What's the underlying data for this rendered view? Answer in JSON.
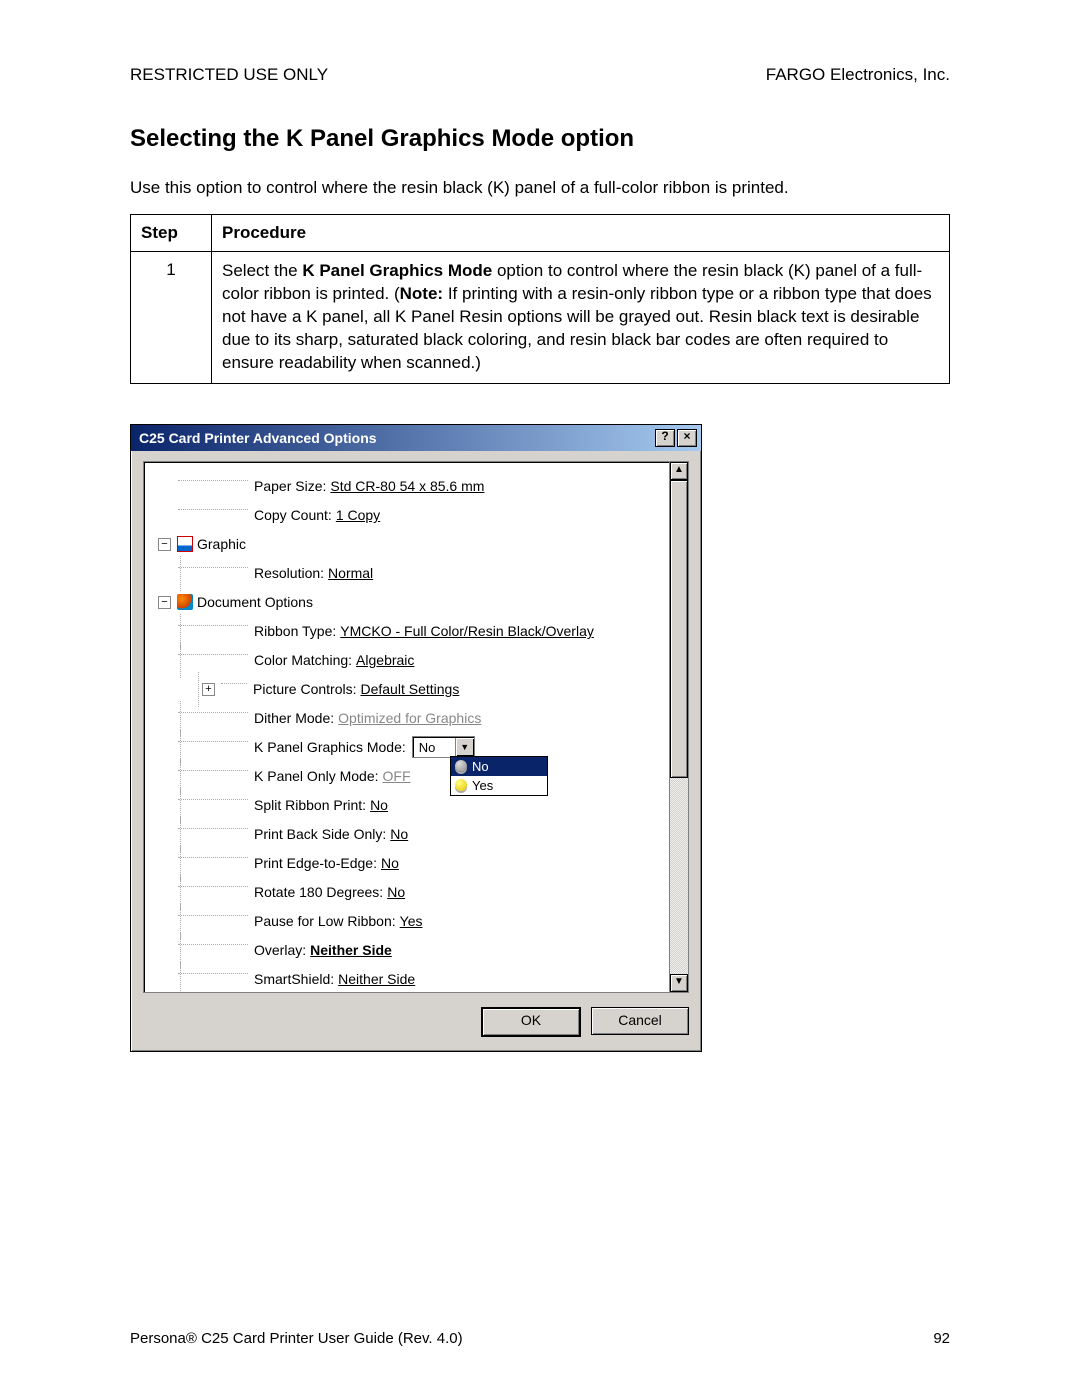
{
  "header": {
    "left": "RESTRICTED USE ONLY",
    "right": "FARGO Electronics, Inc."
  },
  "section_title": "Selecting the K Panel Graphics Mode option",
  "intro": "Use this option to control where the resin black (K) panel of a full-color ribbon is printed.",
  "table": {
    "header_step": "Step",
    "header_proc": "Procedure",
    "row": {
      "step": "1",
      "before_bold1": "Select the ",
      "bold1": "K Panel Graphics Mode",
      "mid": " option to control where the resin black (K) panel of a full-color ribbon is printed.  (",
      "bold2": "Note:",
      "after": "  If printing with a resin-only ribbon type or a ribbon type that does not have a K panel, all K Panel Resin options will be grayed out.  Resin black text is desirable due to its sharp, saturated black coloring, and resin black bar codes are often required to ensure readability when scanned.)"
    }
  },
  "dialog": {
    "title": "C25 Card Printer Advanced Options",
    "help_btn": "?",
    "close_btn": "×",
    "ok": "OK",
    "cancel": "Cancel",
    "scroll_up": "▲",
    "scroll_down": "▼",
    "tree": {
      "paper_size_l": "Paper Size:",
      "paper_size_v": "Std CR-80  54 x 85.6 mm",
      "copy_count_l": "Copy Count:",
      "copy_count_v": "1 Copy",
      "graphic": "Graphic",
      "resolution_l": "Resolution:",
      "resolution_v": "Normal",
      "doc_options": "Document Options",
      "ribbon_l": "Ribbon Type:",
      "ribbon_v": "YMCKO - Full Color/Resin Black/Overlay",
      "colormatch_l": "Color Matching:",
      "colormatch_v": "Algebraic",
      "picturectl_l": "Picture Controls:",
      "picturectl_v": "Default Settings",
      "dither_l": "Dither Mode:",
      "dither_v": "Optimized for Graphics",
      "kpanelgfx_l": "K Panel Graphics Mode:",
      "kpanelgfx_sel": "No",
      "kpanelonly_l": "K Panel Only Mode:",
      "kpanelonly_v": "OFF",
      "split_l": "Split Ribbon Print:",
      "split_v": "No",
      "back_l": "Print Back Side Only:",
      "back_v": "No",
      "edge_l": "Print Edge-to-Edge:",
      "edge_v": "No",
      "rotate_l": "Rotate 180 Degrees:",
      "rotate_v": "No",
      "pause_l": "Pause for Low Ribbon:",
      "pause_v": "Yes",
      "overlay_l": "Overlay:",
      "overlay_v": "Neither Side",
      "smart_l": "SmartShield:",
      "smart_v": "Neither Side",
      "dd_no": "No",
      "dd_yes": "Yes",
      "expand_minus": "−",
      "expand_plus": "+"
    }
  },
  "footer": {
    "left": "Persona® C25 Card Printer User Guide (Rev. 4.0)",
    "right": "92"
  }
}
